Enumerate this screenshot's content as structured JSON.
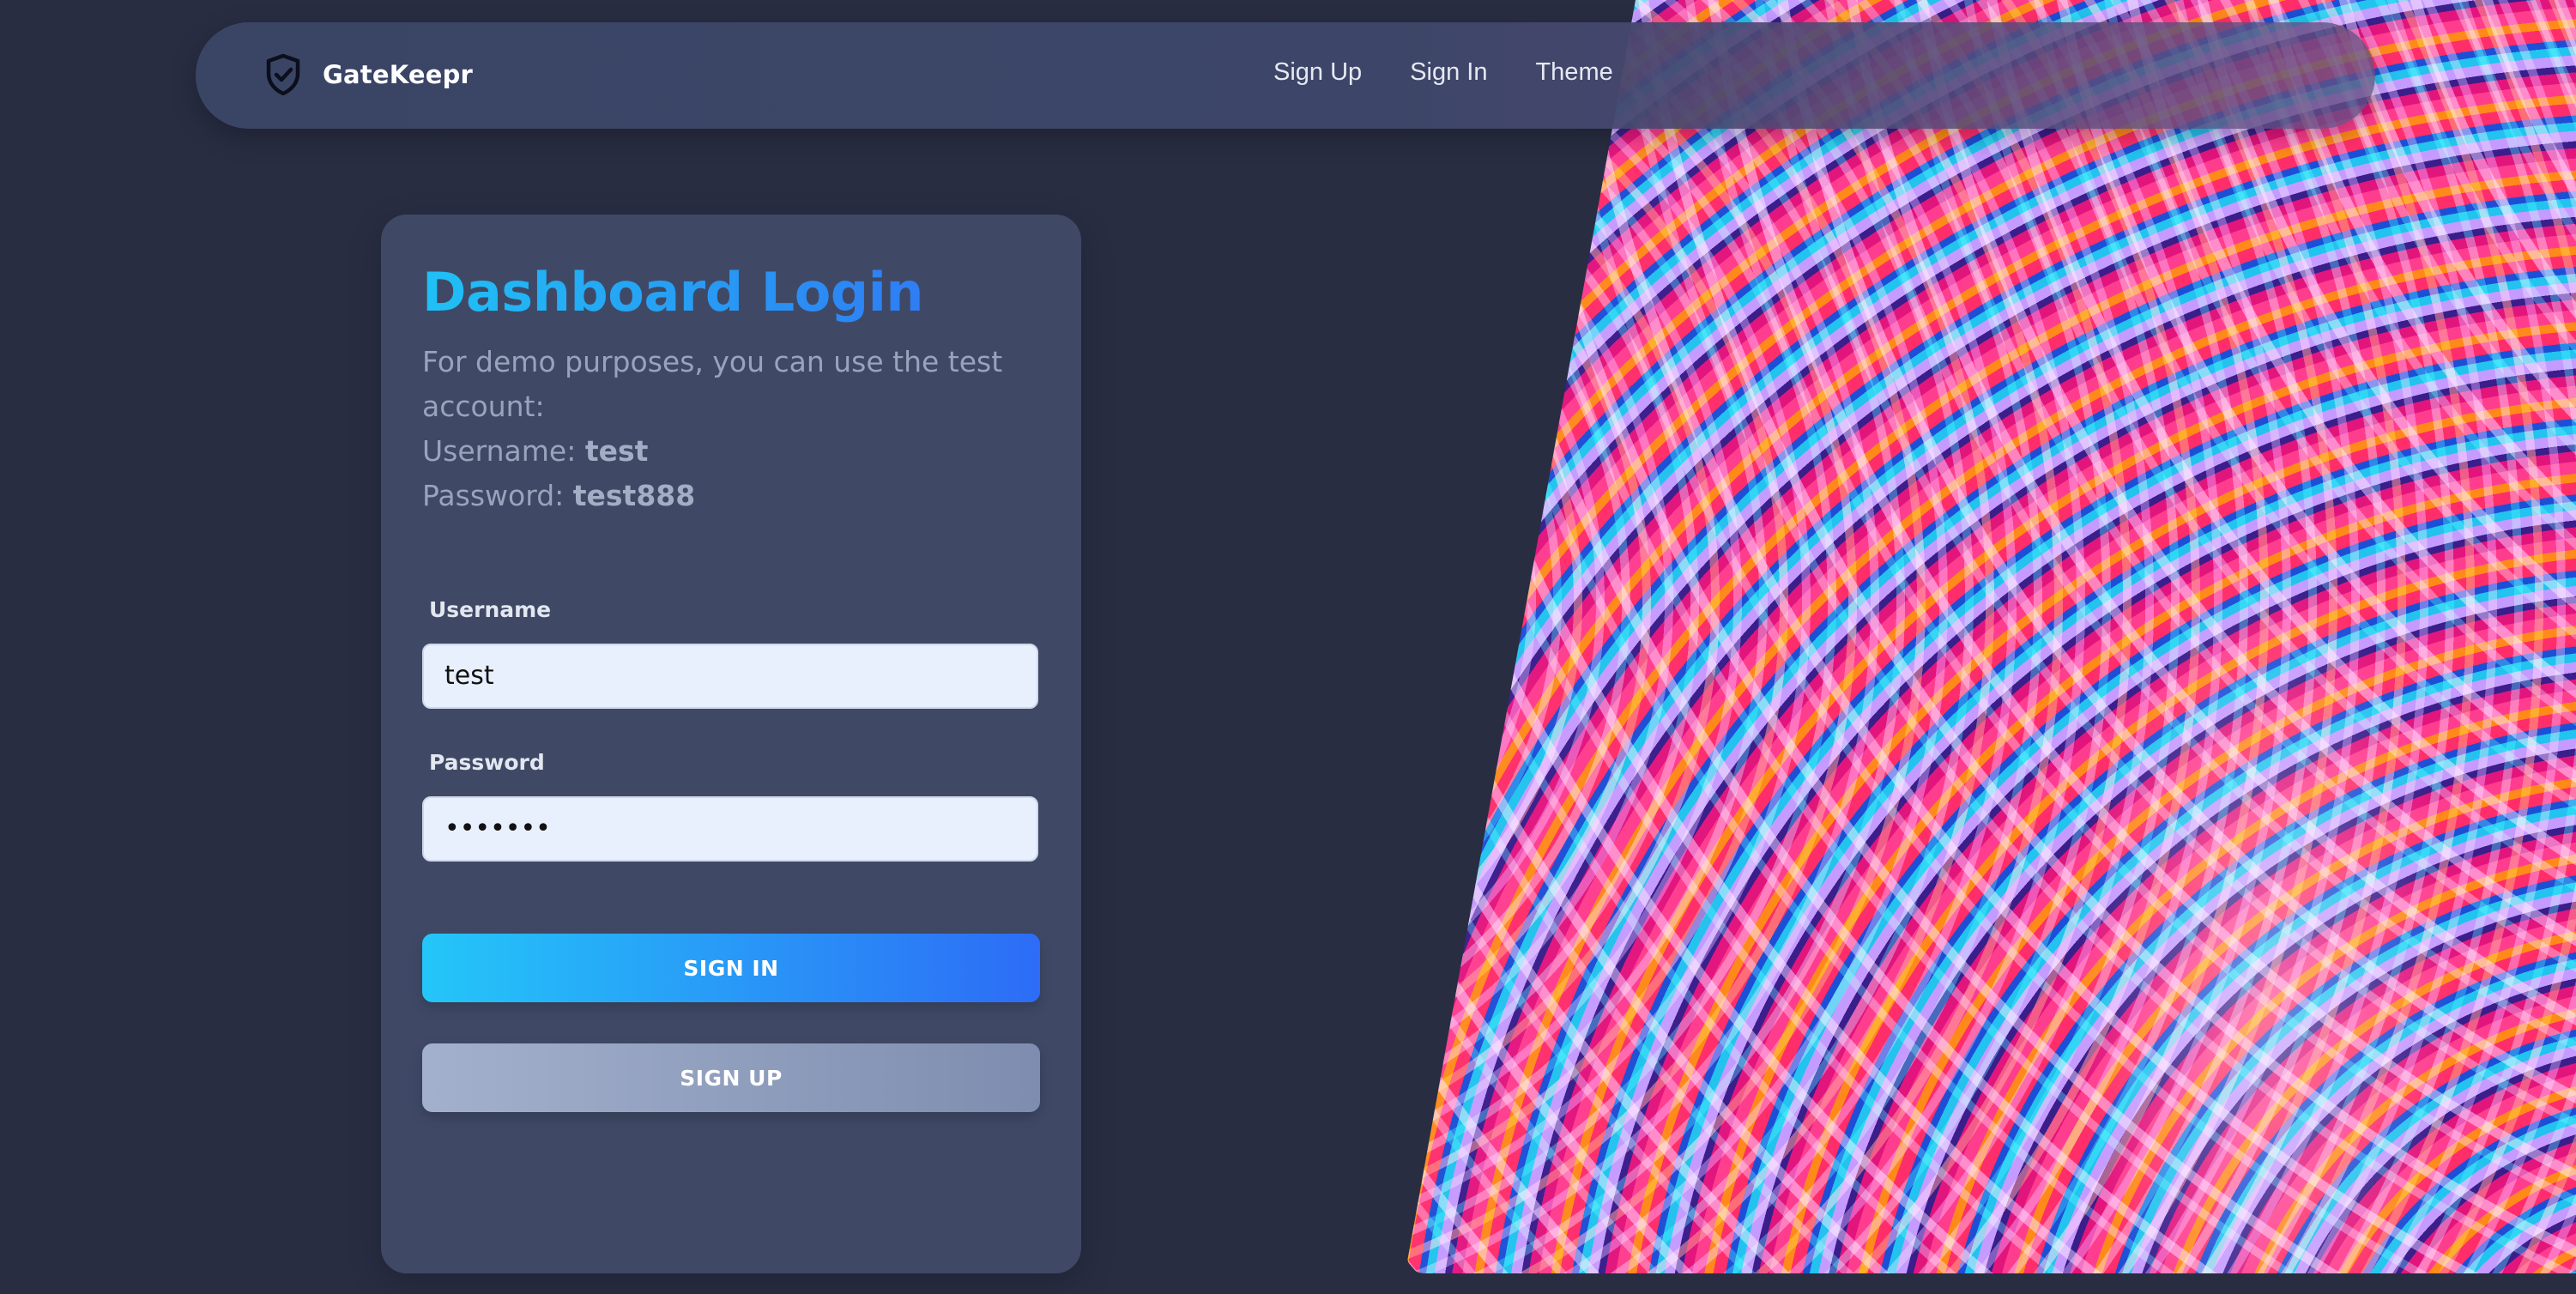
{
  "navbar": {
    "brand": "GateKeepr",
    "brand_icon": "shield-check-icon",
    "links": [
      "Sign Up",
      "Sign In",
      "Theme"
    ]
  },
  "login": {
    "title": "Dashboard Login",
    "demo_text": "For demo purposes, you can use the test account:",
    "username_hint_label": "Username: ",
    "username_hint_value": "test",
    "password_hint_label": "Password: ",
    "password_hint_value": "test888",
    "username_label": "Username",
    "username_value": "test",
    "password_label": "Password",
    "password_value": "•••••••",
    "sign_in_button": "SIGN IN",
    "sign_up_button": "SIGN UP"
  },
  "colors": {
    "background": "#282d42",
    "card": "#3f4966",
    "title_gradient": [
      "#1fc1f5",
      "#2f7df4"
    ],
    "sign_in_gradient": [
      "#24c6f8",
      "#2d6cf6"
    ],
    "sign_up_gradient": [
      "#a3b0cd",
      "#7e8daf"
    ],
    "input_background": "#e8f0fe"
  }
}
